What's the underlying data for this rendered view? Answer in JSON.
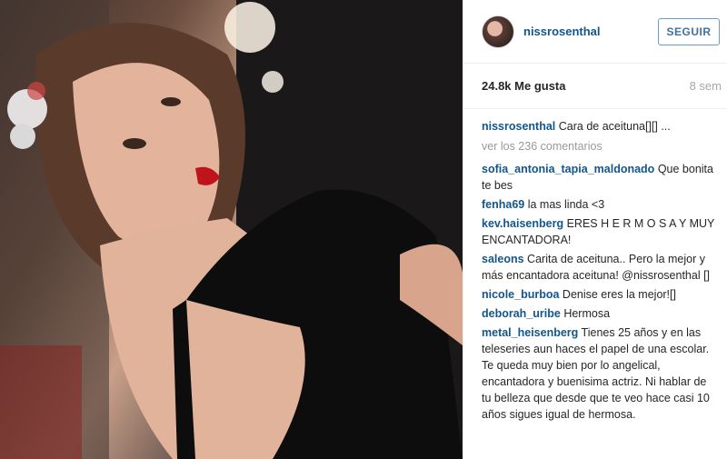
{
  "post": {
    "username": "nissrosenthal",
    "follow_label": "SEGUIR",
    "likes": "24.8k Me gusta",
    "time_ago": "8 sem",
    "caption": {
      "user": "nissrosenthal",
      "text": "Cara de aceituna[][] ..."
    },
    "more_comments": "ver los 236 comentarios"
  },
  "comments": [
    {
      "user": "sofia_antonia_tapia_maldonado",
      "text": "Que bonita te bes"
    },
    {
      "user": "fenha69",
      "text": "la mas linda <3"
    },
    {
      "user": "kev.haisenberg",
      "text": "ERES H E R M O S A Y MUY ENCANTADORA!"
    },
    {
      "user": "saleons",
      "text": "Carita de aceituna.. Pero la mejor y más encantadora aceituna! @nissrosenthal []"
    },
    {
      "user": "nicole_burboa",
      "text": "Denise eres la mejor![]"
    },
    {
      "user": "deborah_uribe",
      "text": "Hermosa"
    },
    {
      "user": "metal_heisenberg",
      "text": "Tienes 25 años y en las teleseries aun haces el papel de una escolar. Te queda muy bien por lo angelical, encantadora y buenisima actriz. Ni hablar de tu belleza que desde que te veo hace casi 10 años sigues igual de hermosa."
    }
  ]
}
